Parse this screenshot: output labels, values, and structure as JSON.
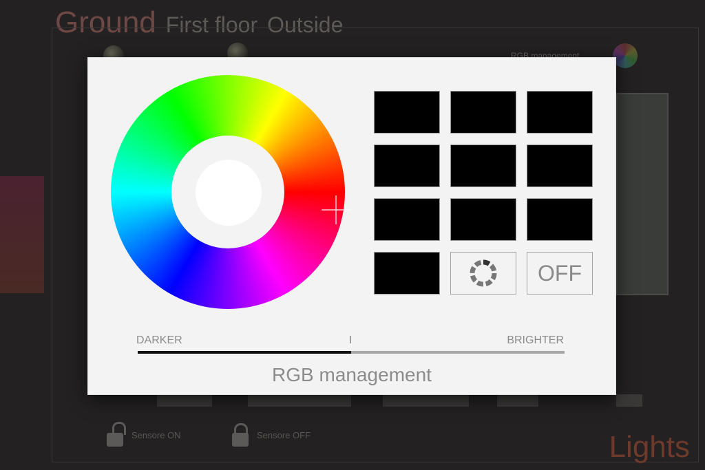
{
  "app": {
    "floor_tabs": [
      {
        "label": "Ground",
        "active": true
      },
      {
        "label": "First floor",
        "active": false
      },
      {
        "label": "Outside",
        "active": false
      }
    ],
    "rgb_label": "RGB management",
    "sensors": [
      {
        "label": "Sensore ON",
        "icon": "unlocked-padlock-icon"
      },
      {
        "label": "Sensore OFF",
        "icon": "locked-padlock-icon"
      }
    ],
    "section_label": "Lights"
  },
  "modal": {
    "title": "RGB management",
    "color_wheel": {
      "selected_color": "#ffffff",
      "icon": "crosshair-icon"
    },
    "swatches": [
      "#000000",
      "#000000",
      "#000000",
      "#000000",
      "#000000",
      "#000000",
      "#000000",
      "#000000",
      "#000000",
      "#000000"
    ],
    "cycle_button": {
      "icon": "cycle-ring-icon"
    },
    "off_button": {
      "label": "OFF"
    },
    "brightness": {
      "left_label": "DARKER",
      "mid_label": "I",
      "right_label": "BRIGHTER",
      "value_fraction": 0.5
    }
  },
  "colors": {
    "accent_tab": "#6e4845",
    "lights_label": "#6e3a2c",
    "swatch": "#000000"
  }
}
